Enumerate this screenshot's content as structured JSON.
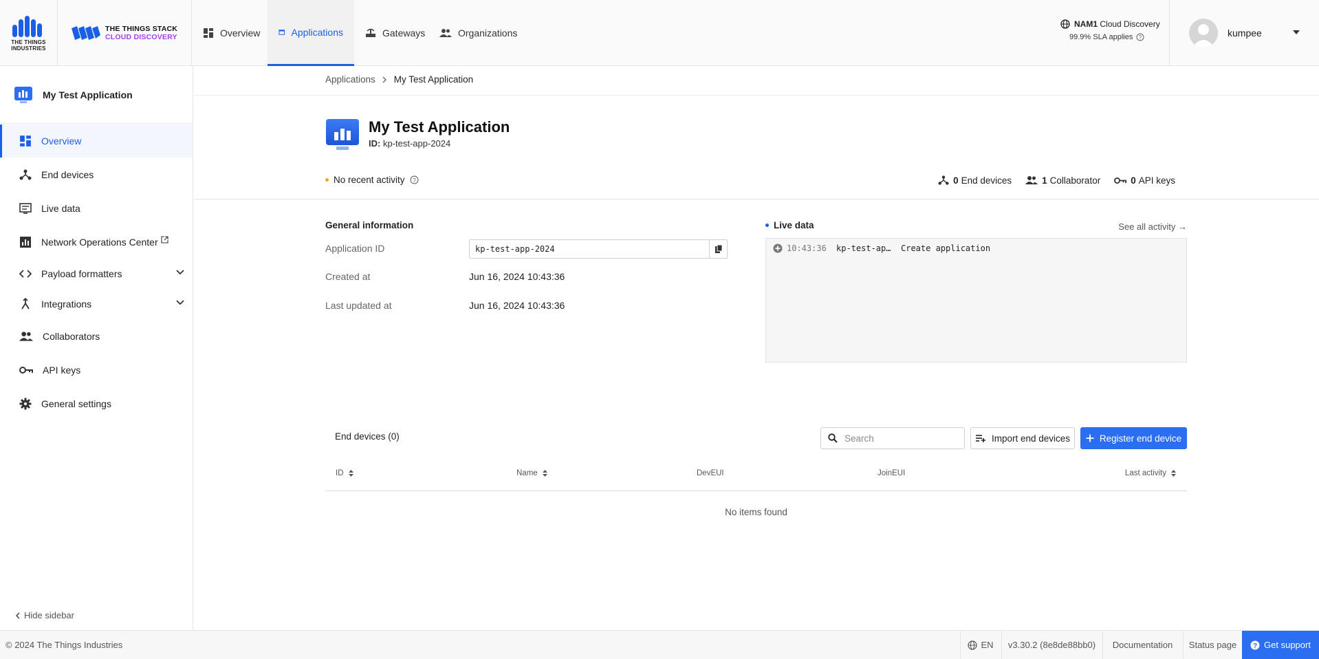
{
  "header": {
    "brand_line1": "THE THINGS STACK",
    "brand_line2": "CLOUD DISCOVERY",
    "tti_logo_text_1": "THE THINGS",
    "tti_logo_text_2": "INDUSTRIES",
    "nav": [
      {
        "label": "Overview",
        "icon": "dashboard-icon"
      },
      {
        "label": "Applications",
        "icon": "application-icon",
        "active": true
      },
      {
        "label": "Gateways",
        "icon": "gateway-icon"
      },
      {
        "label": "Organizations",
        "icon": "organization-icon"
      }
    ],
    "region_code": "NAM1",
    "region_label": "Cloud Discovery",
    "sla": "99.9% SLA applies",
    "username": "kumpee"
  },
  "sidebar": {
    "app_name": "My Test Application",
    "items": [
      {
        "label": "Overview",
        "icon": "dashboard-icon",
        "active": true
      },
      {
        "label": "End devices",
        "icon": "devices-icon"
      },
      {
        "label": "Live data",
        "icon": "live-data-icon"
      },
      {
        "label": "Network Operations Center",
        "icon": "chart-icon",
        "external": true
      },
      {
        "label": "Payload formatters",
        "icon": "code-icon",
        "expandable": true
      },
      {
        "label": "Integrations",
        "icon": "integration-icon",
        "expandable": true
      },
      {
        "label": "Collaborators",
        "icon": "collaborators-icon"
      },
      {
        "label": "API keys",
        "icon": "key-icon"
      },
      {
        "label": "General settings",
        "icon": "gear-icon"
      }
    ],
    "hide_label": "Hide sidebar"
  },
  "breadcrumb": {
    "root": "Applications",
    "current": "My Test Application"
  },
  "app": {
    "title": "My Test Application",
    "id_label": "ID:",
    "id": "kp-test-app-2024",
    "activity": "No recent activity",
    "stats": {
      "end_devices_count": "0",
      "end_devices_label": "End devices",
      "collaborators_count": "1",
      "collaborators_label": "Collaborator",
      "api_keys_count": "0",
      "api_keys_label": "API keys"
    }
  },
  "general_info": {
    "title": "General information",
    "app_id_label": "Application ID",
    "app_id_value": "kp-test-app-2024",
    "created_label": "Created at",
    "created_value": "Jun 16, 2024 10:43:36",
    "updated_label": "Last updated at",
    "updated_value": "Jun 16, 2024 10:43:36"
  },
  "live_data": {
    "title": "Live data",
    "see_all": "See all activity →",
    "events": [
      {
        "time": "10:43:36",
        "entity": "kp-test-ap…",
        "event": "Create application"
      }
    ]
  },
  "end_devices": {
    "title": "End devices (0)",
    "search_placeholder": "Search",
    "import_label": "Import end devices",
    "register_label": "Register end device",
    "columns": [
      "ID",
      "Name",
      "DevEUI",
      "JoinEUI",
      "Last activity"
    ],
    "empty": "No items found"
  },
  "footer": {
    "copyright": "© 2024 The Things Industries",
    "language": "EN",
    "version": "v3.30.2 (8e8de88bb0)",
    "documentation": "Documentation",
    "status_page": "Status page",
    "support": "Get support"
  },
  "colors": {
    "primary": "#1a5fe6",
    "button_blue": "#2b6ef2",
    "brand_purple": "#a63ef0",
    "activity_dot": "#f5a623"
  }
}
